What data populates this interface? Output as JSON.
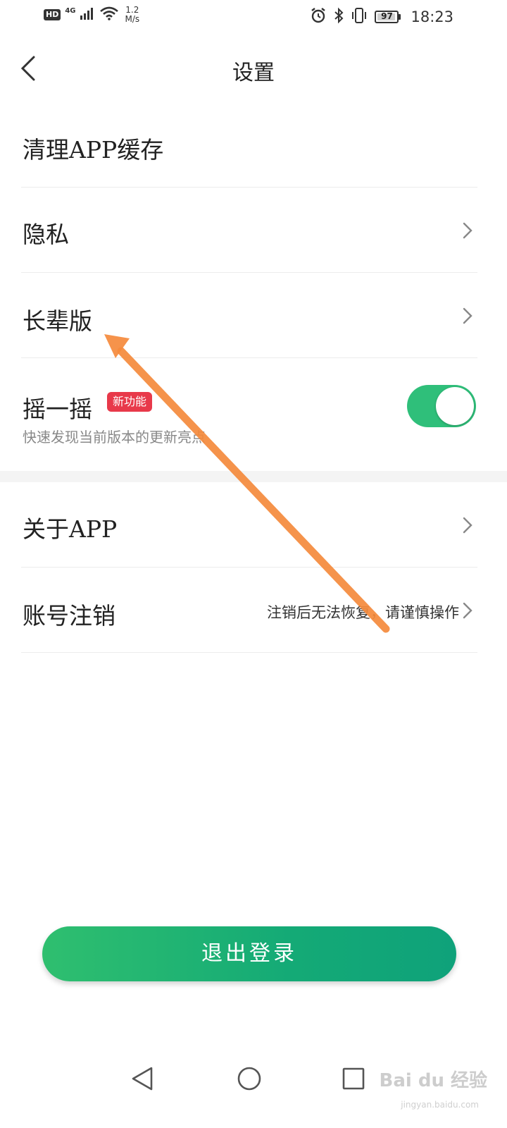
{
  "status_bar": {
    "hd": "HD",
    "network": "4G",
    "speed_value": "1.2",
    "speed_unit": "M/s",
    "battery": "97",
    "battery_level": 0.97,
    "time": "18:23"
  },
  "header": {
    "title": "设置",
    "back_icon": "chevron-left-icon"
  },
  "settings": {
    "items": [
      {
        "label": "清理APP缓存"
      },
      {
        "label": "隐私"
      },
      {
        "label": "长辈版"
      },
      {
        "label": "摇一摇",
        "badge": "新功能",
        "subtitle": "快速发现当前版本的更新亮点",
        "toggle_on": true
      },
      {
        "label": "关于APP"
      },
      {
        "label": "账号注销",
        "hint": "注销后无法恢复，请谨慎操作"
      }
    ]
  },
  "logout": {
    "label": "退出登录"
  },
  "nav": {
    "back": "back-triangle-icon",
    "home": "home-circle-icon",
    "recents": "recents-square-icon"
  },
  "watermark": {
    "text": "Bai du 经验",
    "sub": "jingyan.baidu.com"
  },
  "colors": {
    "accent": "#2fbf7a",
    "badge": "#e8394a",
    "annotation_arrow": "#f58a3c"
  }
}
